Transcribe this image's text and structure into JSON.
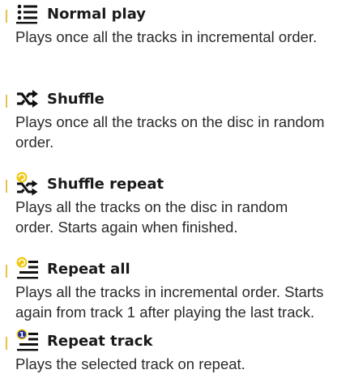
{
  "accent_color": "#e8c04a",
  "badge_yellow": "#f2c811",
  "badge_blue": "#1f2fa0",
  "modes": [
    {
      "icon": "list-icon",
      "title": "Normal play",
      "description": "Plays once all the tracks in incremental order."
    },
    {
      "icon": "shuffle-icon",
      "title": "Shuffle",
      "description": "Plays once all the tracks on the disc in random order."
    },
    {
      "icon": "shuffle-repeat-icon",
      "title": "Shuffle repeat",
      "description": "Plays all the tracks on the disc in random order. Starts again when finished."
    },
    {
      "icon": "repeat-all-icon",
      "title": "Repeat all",
      "description": "Plays all the tracks in incremental order. Starts again from track 1 after playing the last track."
    },
    {
      "icon": "repeat-track-icon",
      "title": "Repeat track",
      "description": "Plays the selected track on repeat.",
      "badge_text": "1"
    }
  ]
}
